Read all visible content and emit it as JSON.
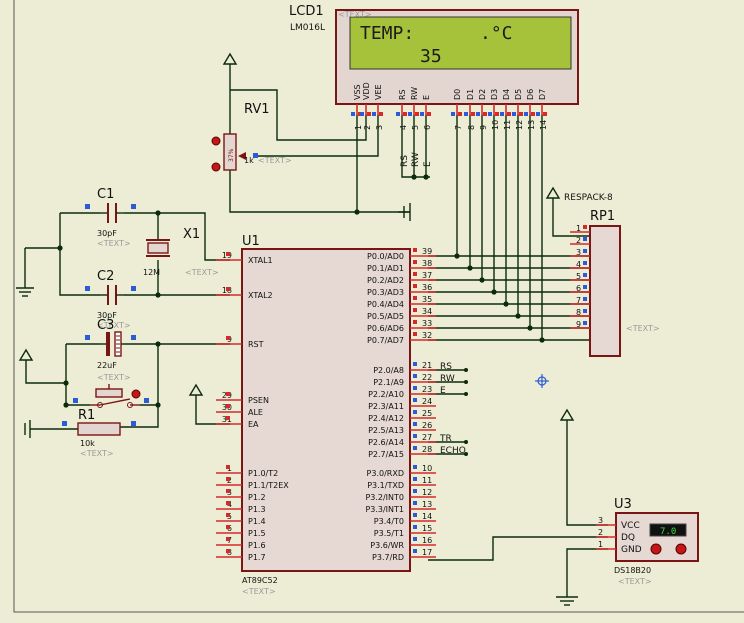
{
  "colors": {
    "background": "#ededd6",
    "wire": "#0b2b0b",
    "body": "#8b1a1a",
    "body_fill": "#e6d8d2",
    "pin": "#d42a2a",
    "text": "#111111",
    "placeholder": "#9a9a9a",
    "lcd_screen": "#a6c23a",
    "probe": "#2c5bd8"
  },
  "lcd": {
    "ref": "LCD1",
    "model": "LM016L",
    "placeholder": "<TEXT>",
    "line1_left": "TEMP:",
    "line1_right": ".°C",
    "line2": "35",
    "pin_labels": [
      "VSS",
      "VDD",
      "VEE",
      "RS",
      "RW",
      "E",
      "D0",
      "D1",
      "D2",
      "D3",
      "D4",
      "D5",
      "D6",
      "D7"
    ],
    "pin_numbers": [
      "1",
      "2",
      "3",
      "4",
      "5",
      "6",
      "7",
      "8",
      "9",
      "10",
      "11",
      "12",
      "13",
      "14"
    ],
    "side_labels": [
      "RS",
      "RW",
      "E"
    ]
  },
  "rv1": {
    "ref": "RV1",
    "value": "1k",
    "placeholder": "<TEXT>",
    "percent": "37%"
  },
  "respack": {
    "ref": "RP1",
    "power_label": "RESPACK-8",
    "placeholder": "<TEXT>",
    "pins": [
      "1",
      "2",
      "3",
      "4",
      "5",
      "6",
      "7",
      "8",
      "9"
    ]
  },
  "c1": {
    "ref": "C1",
    "value": "30pF",
    "placeholder": "<TEXT>"
  },
  "c2": {
    "ref": "C2",
    "value": "30pF",
    "placeholder": "<TEXT>"
  },
  "c3": {
    "ref": "C3",
    "value": "22uF",
    "placeholder": "<TEXT>"
  },
  "x1": {
    "ref": "X1",
    "value": "12M",
    "placeholder": "<TEXT>"
  },
  "r1": {
    "ref": "R1",
    "value": "10k",
    "placeholder": "<TEXT>"
  },
  "u1": {
    "ref": "U1",
    "model": "AT89C52",
    "placeholder": "<TEXT>",
    "left_pins": [
      {
        "num": "19",
        "label": "XTAL1"
      },
      {
        "num": "18",
        "label": "XTAL2"
      },
      {
        "num": "9",
        "label": "RST"
      },
      {
        "num": "29",
        "label": "PSEN"
      },
      {
        "num": "30",
        "label": "ALE"
      },
      {
        "num": "31",
        "label": "EA"
      },
      {
        "num": "1",
        "label": "P1.0/T2"
      },
      {
        "num": "2",
        "label": "P1.1/T2EX"
      },
      {
        "num": "3",
        "label": "P1.2"
      },
      {
        "num": "4",
        "label": "P1.3"
      },
      {
        "num": "5",
        "label": "P1.4"
      },
      {
        "num": "6",
        "label": "P1.5"
      },
      {
        "num": "7",
        "label": "P1.6"
      },
      {
        "num": "8",
        "label": "P1.7"
      }
    ],
    "right_pins": [
      {
        "num": "39",
        "label": "P0.0/AD0"
      },
      {
        "num": "38",
        "label": "P0.1/AD1"
      },
      {
        "num": "37",
        "label": "P0.2/AD2"
      },
      {
        "num": "36",
        "label": "P0.3/AD3"
      },
      {
        "num": "35",
        "label": "P0.4/AD4"
      },
      {
        "num": "34",
        "label": "P0.5/AD5"
      },
      {
        "num": "33",
        "label": "P0.6/AD6"
      },
      {
        "num": "32",
        "label": "P0.7/AD7"
      },
      {
        "num": "21",
        "label": "P2.0/A8"
      },
      {
        "num": "22",
        "label": "P2.1/A9"
      },
      {
        "num": "23",
        "label": "P2.2/A10"
      },
      {
        "num": "24",
        "label": "P2.3/A11"
      },
      {
        "num": "25",
        "label": "P2.4/A12"
      },
      {
        "num": "26",
        "label": "P2.5/A13"
      },
      {
        "num": "27",
        "label": "P2.6/A14"
      },
      {
        "num": "28",
        "label": "P2.7/A15"
      },
      {
        "num": "10",
        "label": "P3.0/RXD"
      },
      {
        "num": "11",
        "label": "P3.1/TXD"
      },
      {
        "num": "12",
        "label": "P3.2/INT0"
      },
      {
        "num": "13",
        "label": "P3.3/INT1"
      },
      {
        "num": "14",
        "label": "P3.4/T0"
      },
      {
        "num": "15",
        "label": "P3.5/T1"
      },
      {
        "num": "16",
        "label": "P3.6/WR"
      },
      {
        "num": "17",
        "label": "P3.7/RD"
      }
    ],
    "port2_net_labels": [
      "RS",
      "RW",
      "E",
      "",
      "",
      "",
      "TR",
      "ECHO"
    ]
  },
  "u3": {
    "ref": "U3",
    "model": "DS18B20",
    "placeholder": "<TEXT>",
    "display": "7.0",
    "pins": [
      {
        "num": "3",
        "label": "VCC"
      },
      {
        "num": "2",
        "label": "DQ"
      },
      {
        "num": "1",
        "label": "GND"
      }
    ]
  }
}
